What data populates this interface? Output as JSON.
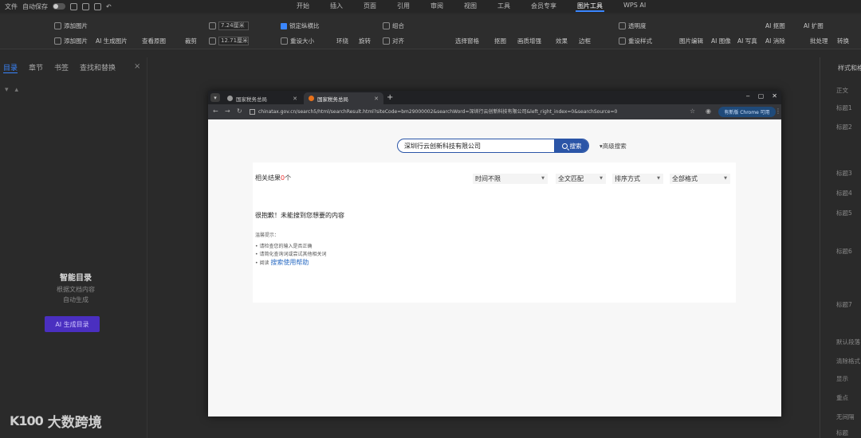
{
  "wps": {
    "top_left": [
      "文件",
      "自动保存"
    ],
    "tabs": [
      {
        "label": "开始",
        "active": false
      },
      {
        "label": "插入",
        "active": false
      },
      {
        "label": "页面",
        "active": false
      },
      {
        "label": "引用",
        "active": false
      },
      {
        "label": "审阅",
        "active": false
      },
      {
        "label": "视图",
        "active": false
      },
      {
        "label": "工具",
        "active": false
      },
      {
        "label": "会员专享",
        "active": false
      },
      {
        "label": "图片工具",
        "active": true
      },
      {
        "label": "WPS AI",
        "active": false
      }
    ],
    "ribbon": {
      "replace_image": "添加图片",
      "add_image": "添加图片",
      "ai_generate": "AI 生成图片",
      "view_original": "查看原图",
      "crop": "裁剪",
      "height": "7.24厘米",
      "width": "12.71厘米",
      "lock_ratio": "锁定纵横比",
      "reset_size": "重设大小",
      "wrap": "环绕",
      "rotate": "旋转",
      "combine": "组合",
      "align": "对齐",
      "select_pane": "选择窗格",
      "cutout": "抠图",
      "sharpen": "画质增强",
      "effects": "效果",
      "border": "边框",
      "clear": "透明度",
      "reset_style": "重设样式",
      "image_edit": "图片编辑",
      "ai_image": "AI 图像",
      "ai_portrait": "AI 写真",
      "ai_cutout": "AI 抠图",
      "ai_remove": "AI 消除",
      "ai_expand": "AI 扩图",
      "batch": "批处理",
      "transform": "转换"
    },
    "sidebar": {
      "tabs": [
        {
          "label": "目录",
          "active": true
        },
        {
          "label": "章节",
          "active": false
        },
        {
          "label": "书签",
          "active": false
        },
        {
          "label": "查找和替换",
          "active": false
        }
      ],
      "controls": [
        "▾",
        "▴"
      ],
      "smart_toc_title": "智能目录",
      "smart_toc_line1": "根据文档内容",
      "smart_toc_line2": "自动生成",
      "ai_generate_button": "AI 生成目录"
    },
    "right_panel": {
      "header": "样式和格式",
      "items": [
        "正文",
        "标题1",
        "标题2",
        "标题3",
        "标题4",
        "标题5",
        "标题6",
        "标题7",
        "默认段落",
        "清除格式",
        "显示",
        "重点",
        "无间隔",
        "标题"
      ]
    }
  },
  "watermark": {
    "logo": "K100",
    "text": "大数跨境"
  },
  "chrome": {
    "tabs": [
      {
        "title": "国家税务总局",
        "active": false
      },
      {
        "title": "国家税务总局",
        "active": true
      }
    ],
    "new_tab": "+",
    "url": "chinatax.gov.cn/search5/html/searchResult.html?siteCode=bm29000002&searchWord=深圳行云创新科技有限公司&left_right_index=0&searchSource=0",
    "update_button": "有新版 Chrome 可用",
    "window_controls": [
      "‒",
      "▢",
      "✕"
    ]
  },
  "page": {
    "search_value": "深圳行云创新科技有限公司",
    "search_button": "搜索",
    "advanced_search": "▾高级搜索",
    "result_label": "相关结果",
    "result_count": "0",
    "result_unit": "个",
    "filters": [
      {
        "label": "时间不限"
      },
      {
        "label": "全文匹配"
      },
      {
        "label": "排序方式"
      },
      {
        "label": "全部格式"
      }
    ],
    "sorry": "很抱歉！未能搜到您想要的内容",
    "tips_title": "温馨提示：",
    "tips": [
      "请检查您的输入是否正确",
      "请简化查询词或尝试其他相关词"
    ],
    "help_prefix": "阅读",
    "help_link": "搜索使用帮助"
  }
}
